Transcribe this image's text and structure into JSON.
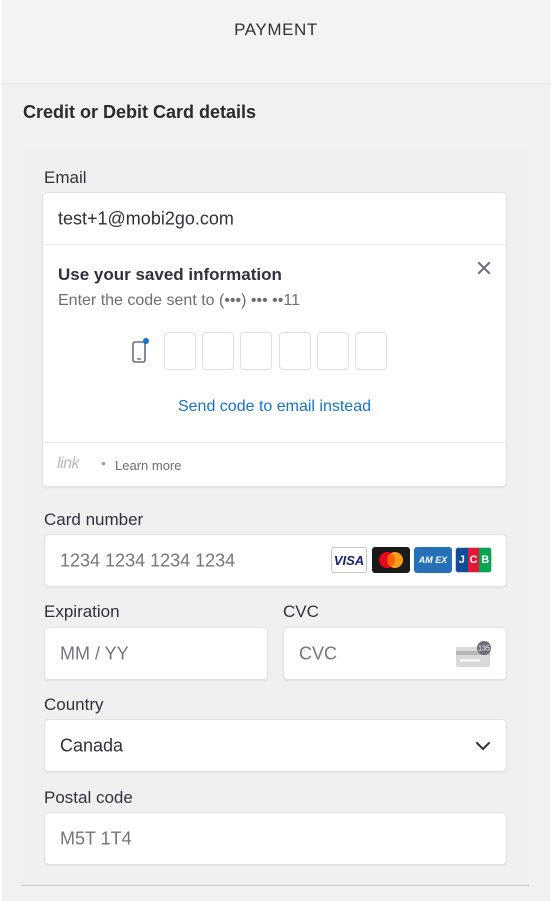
{
  "header": {
    "title": "PAYMENT"
  },
  "section": {
    "title": "Credit or Debit Card details"
  },
  "email": {
    "label": "Email",
    "value": "test+1@mobi2go.com"
  },
  "link_card": {
    "title": "Use your saved information",
    "subtitle": "Enter the code sent to (•••) ••• ••11",
    "code_digits": [
      "",
      "",
      "",
      "",
      "",
      ""
    ],
    "send_link": "Send code to email instead",
    "logo_text": "link",
    "separator": "•",
    "learn_more": "Learn more",
    "accent_color": "#1a73c8"
  },
  "card_number": {
    "label": "Card number",
    "placeholder": "1234 1234 1234 1234",
    "brands": [
      "VISA",
      "Mastercard",
      "AMEX",
      "JCB"
    ],
    "visa_text": "VISA",
    "amex_text": "AM EX",
    "jcb_letters": [
      "J",
      "C",
      "B"
    ]
  },
  "expiration": {
    "label": "Expiration",
    "placeholder": "MM / YY"
  },
  "cvc": {
    "label": "CVC",
    "placeholder": "CVC",
    "icon_text": "135"
  },
  "country": {
    "label": "Country",
    "selected": "Canada"
  },
  "postal_code": {
    "label": "Postal code",
    "placeholder": "M5T 1T4"
  }
}
